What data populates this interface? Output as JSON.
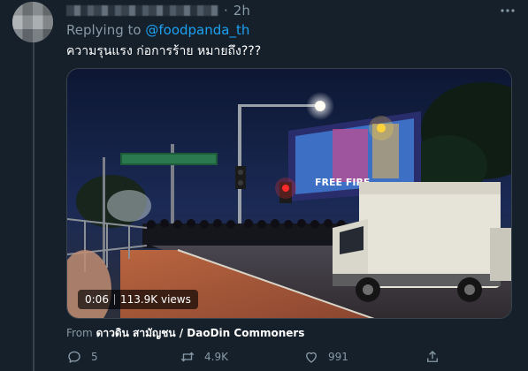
{
  "tweet": {
    "time": "2h",
    "replying_prefix": "Replying to",
    "replying_handle": "@foodpanda_th",
    "text": "ความรุนแรง ก่อการร้าย หมายถึง???",
    "video": {
      "duration": "0:06",
      "views": "113.9K views"
    },
    "from_prefix": "From",
    "from_source": "ดาวดิน สามัญชน / DaoDin Commoners",
    "actions": {
      "replies": "5",
      "retweets": "4.9K",
      "likes": "991"
    }
  },
  "icons": [
    "avatar",
    "more-icon",
    "reply-icon",
    "retweet-icon",
    "like-icon",
    "share-icon"
  ],
  "colors": {
    "background": "#15202b",
    "accent": "#1da1f2",
    "muted": "#8899a6",
    "divider": "#38444d"
  }
}
